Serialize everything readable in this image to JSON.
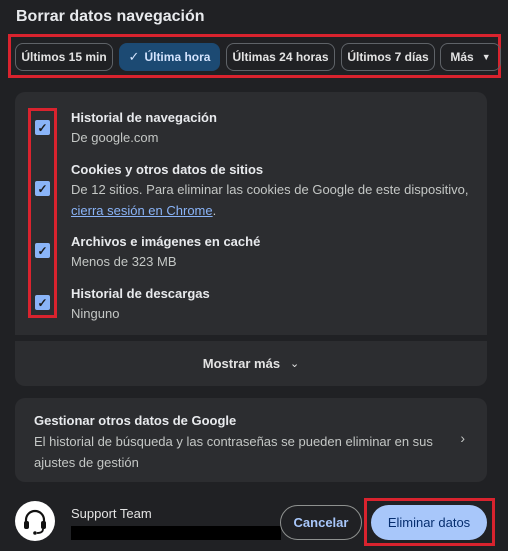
{
  "dialog": {
    "title": "Borrar datos navegación"
  },
  "time_ranges": [
    {
      "label": "Últimos 15 min",
      "selected": false
    },
    {
      "label": "Última hora",
      "selected": true
    },
    {
      "label": "Últimas 24 horas",
      "selected": false
    },
    {
      "label": "Últimos 7 días",
      "selected": false
    },
    {
      "label": "Más",
      "selected": false
    }
  ],
  "items": [
    {
      "title": "Historial de navegación",
      "subtitle": "De google.com",
      "checked": true
    },
    {
      "title": "Cookies y otros datos de sitios",
      "subtitle": "De 12 sitios. Para eliminar las cookies de Google de este dispositivo,",
      "link": "cierra sesión en Chrome",
      "link_suffix": ".",
      "checked": true
    },
    {
      "title": "Archivos e imágenes en caché",
      "subtitle": "Menos de 323 MB",
      "checked": true
    },
    {
      "title": "Historial de descargas",
      "subtitle": "Ninguno",
      "checked": true
    }
  ],
  "show_more": {
    "label": "Mostrar más"
  },
  "manage_google": {
    "title": "Gestionar otros datos de Google",
    "description": "El historial de búsqueda y las contraseñas se pueden eliminar en sus ajustes de gestión"
  },
  "account": {
    "name": "Support Team"
  },
  "footer": {
    "cancel_label": "Cancelar",
    "delete_label": "Eliminar datos"
  },
  "icons": {
    "check": "check-icon",
    "dropdown": "caret-down-icon",
    "expand": "chevron-down-icon",
    "arrow": "chevron-right-icon",
    "avatar": "headset-icon"
  },
  "colors": {
    "background": "#202124",
    "card": "#2c2d30",
    "accent": "#8ab4f8",
    "selected_chip": "#1c4a73",
    "primary_button": "#a8c7fa",
    "highlight": "#d9232e"
  }
}
